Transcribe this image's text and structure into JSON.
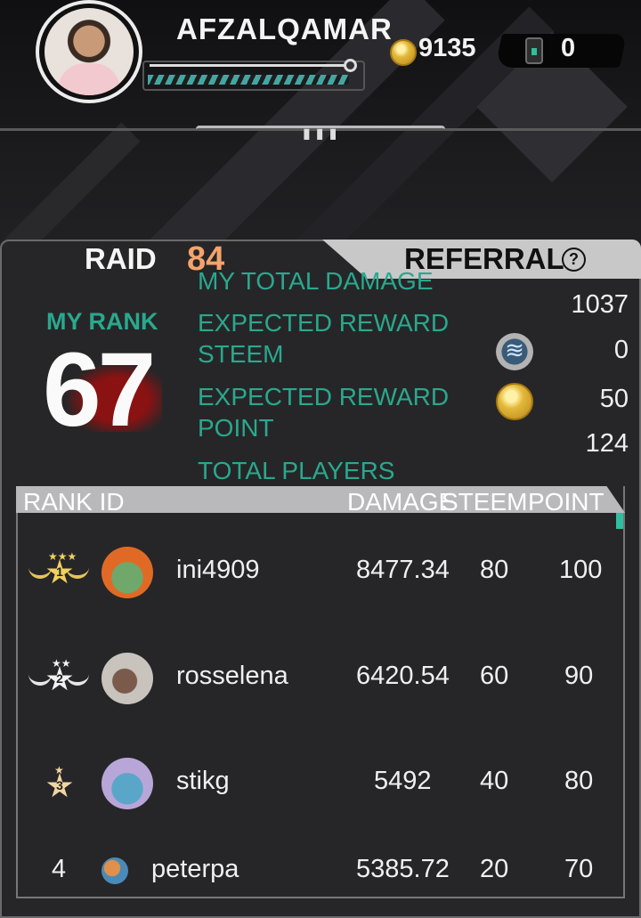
{
  "player": {
    "username": "AFZALQAMAR",
    "coins": "9135",
    "tickets": "0"
  },
  "tabs": {
    "raid_label": "RAID",
    "raid_count": "84",
    "referral_label": "REFERRAL",
    "help_icon": "?"
  },
  "my_rank": {
    "label": "MY RANK",
    "value": "67"
  },
  "stats": {
    "total_damage_label": "MY TOTAL DAMAGE",
    "total_damage_value": "1037",
    "reward_steem_label_1": "EXPECTED REWARD",
    "reward_steem_label_2": "STEEM",
    "reward_steem_value": "0",
    "reward_point_label_1": "EXPECTED REWARD",
    "reward_point_label_2": "POINT",
    "reward_point_value": "50",
    "total_players_label": "TOTAL PLAYERS",
    "total_players_value": "124"
  },
  "table": {
    "headers": [
      "RANK ID",
      "DAMAGE",
      "STEEM",
      "POINT"
    ],
    "rows": [
      {
        "rank": "1",
        "id": "ini4909",
        "damage": "8477.34",
        "steem": "80",
        "point": "100"
      },
      {
        "rank": "2",
        "id": "rosselena",
        "damage": "6420.54",
        "steem": "60",
        "point": "90"
      },
      {
        "rank": "3",
        "id": "stikg",
        "damage": "5492",
        "steem": "40",
        "point": "80"
      },
      {
        "rank": "4",
        "id": "peterpa",
        "damage": "5385.72",
        "steem": "20",
        "point": "70"
      }
    ]
  },
  "icons": {
    "coin": "coin-icon",
    "ticket": "ticket-icon",
    "steem": "steem-icon",
    "medal_gold": "gold-medal-icon",
    "medal_silver": "silver-medal-icon",
    "medal_bronze": "bronze-medal-icon"
  },
  "colors": {
    "accent_teal": "#2aa88e",
    "raid_count": "#f3a36c",
    "panel": "#262628"
  }
}
